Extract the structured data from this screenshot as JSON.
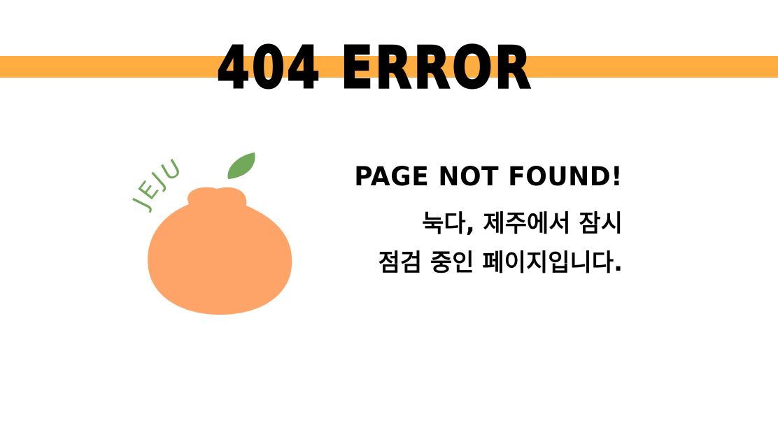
{
  "error": {
    "title": "404 ERROR",
    "band_color": "#ffac40"
  },
  "illustration": {
    "label": "JEJU",
    "fruit_color": "#ffa468",
    "leaf_color": "#72a85a",
    "icon": "tangerine-icon"
  },
  "message": {
    "headline": "PAGE NOT FOUND!",
    "line1": "눅다, 제주에서 잠시",
    "line2": "점검 중인 페이지입니다."
  }
}
